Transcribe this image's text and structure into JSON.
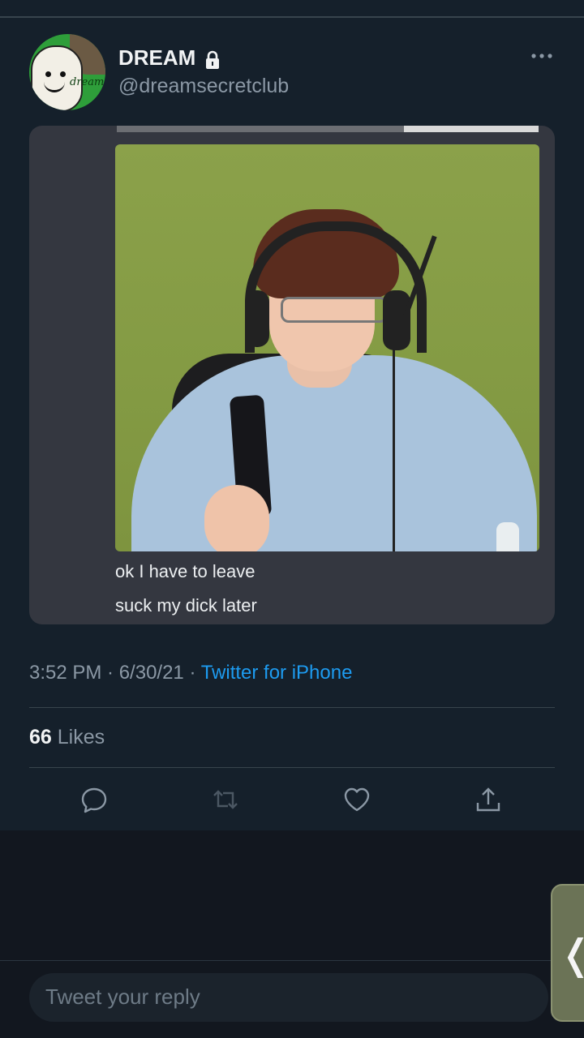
{
  "tweet": {
    "author": {
      "display_name": "DREAM",
      "handle": "@dreamsecretclub",
      "avatar_text": "dream",
      "protected_icon": "lock-icon"
    },
    "more_icon": "more-horizontal-icon",
    "media_caption_lines": [
      "ok I have to leave",
      "suck my dick later"
    ],
    "timestamp": "3:52 PM · 6/30/21 · ",
    "source": "Twitter for iPhone",
    "likes": {
      "count": "66",
      "label": " Likes"
    },
    "actions": [
      "reply-icon",
      "retweet-icon",
      "like-icon",
      "share-icon"
    ]
  },
  "reply": {
    "placeholder": "Tweet your reply"
  },
  "side_handle": {
    "icon": "chevron-left-icon",
    "glyph": "❬"
  },
  "colors": {
    "background": "#15202b",
    "accent": "#1d9bf0",
    "secondary_text": "#8b98a5"
  }
}
